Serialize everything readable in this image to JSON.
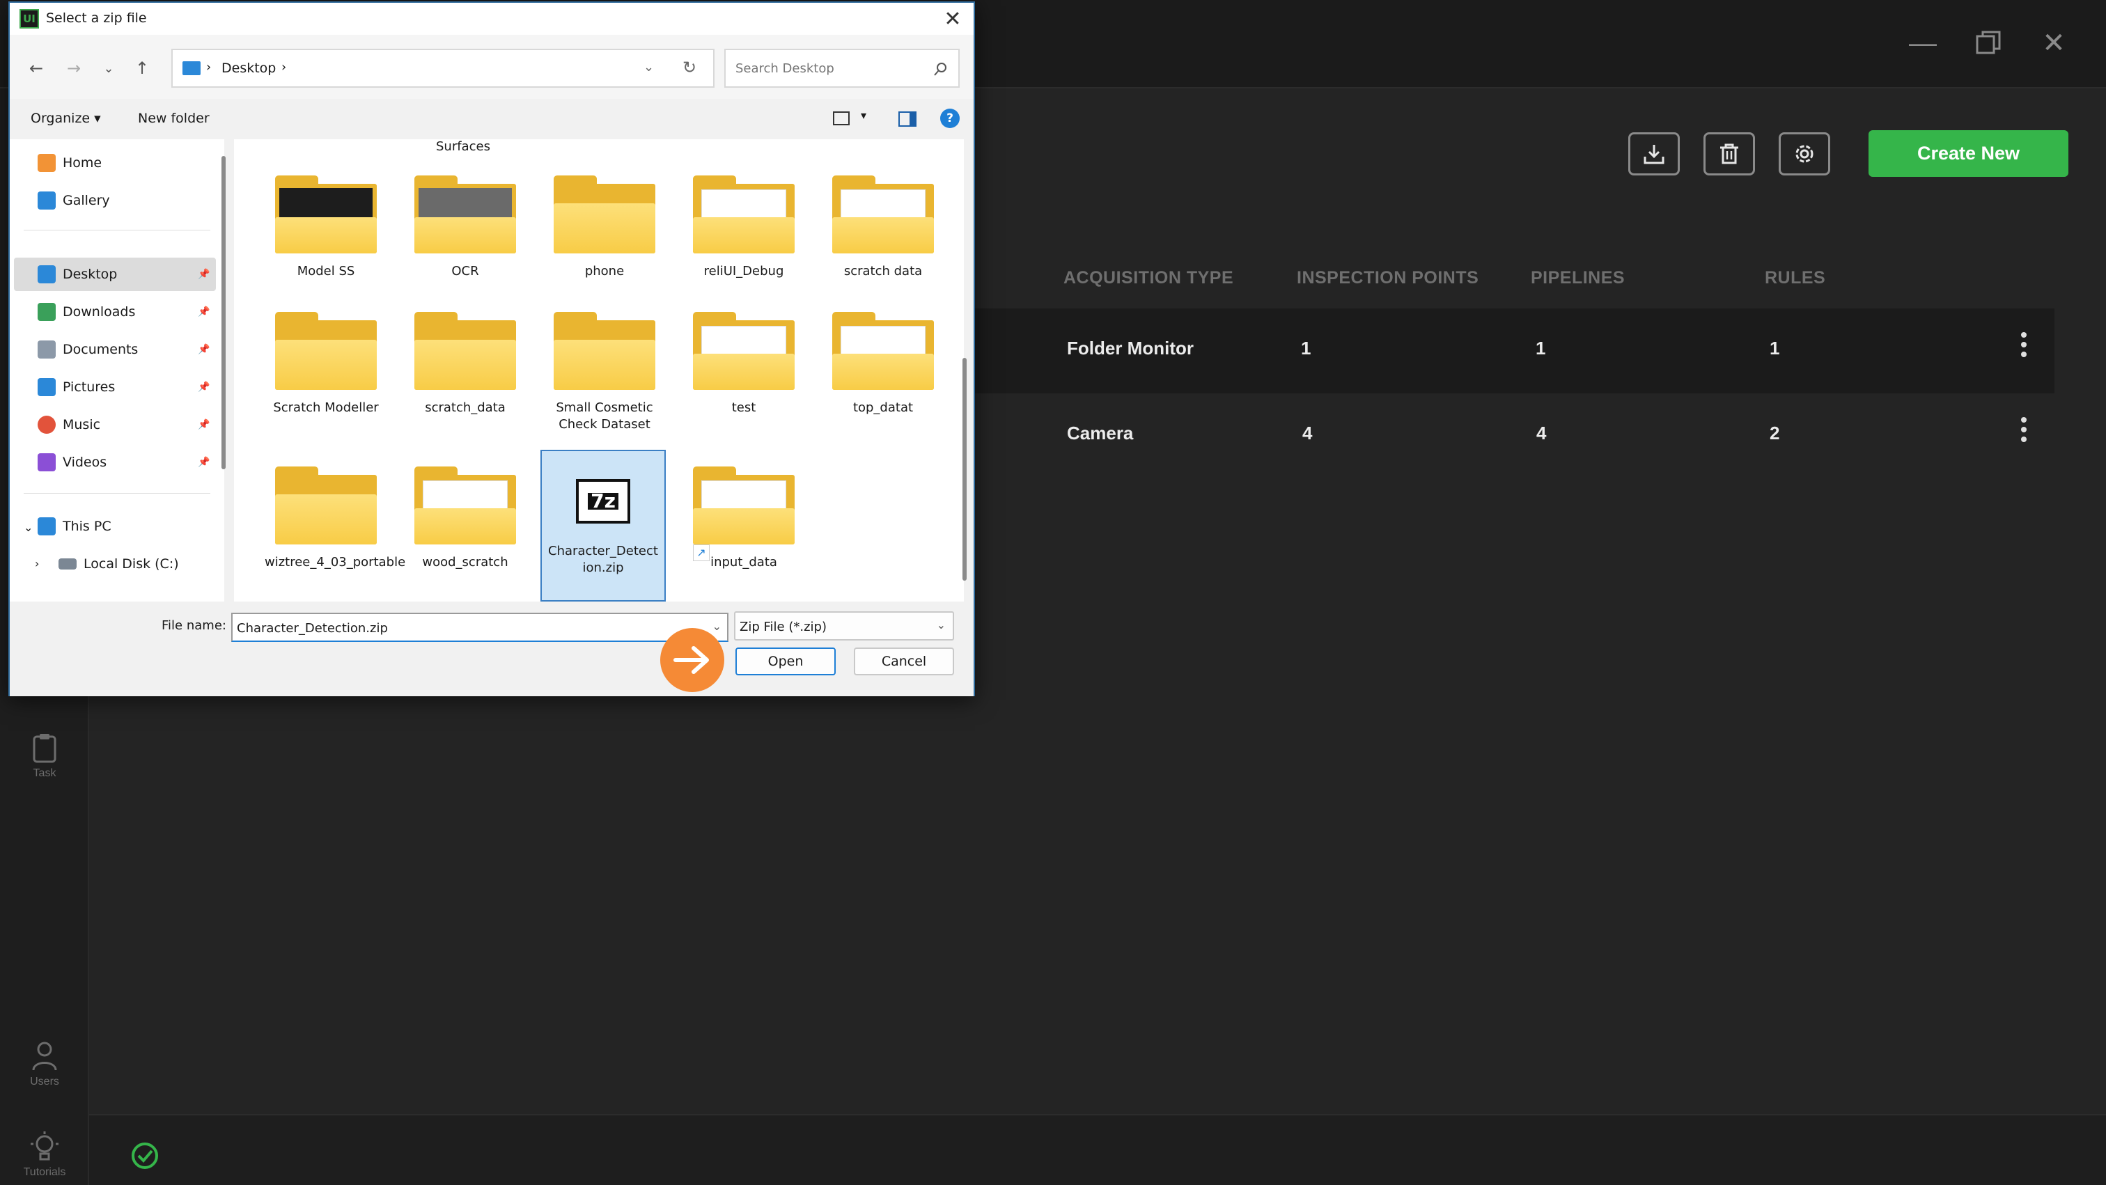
{
  "app": {
    "toolbar": {
      "create_new": "Create New"
    },
    "table": {
      "headers": [
        "ACQUISITION TYPE",
        "INSPECTION POINTS",
        "PIPELINES",
        "RULES"
      ],
      "rows": [
        {
          "acquisition_type": "Folder Monitor",
          "inspection_points": "1",
          "pipelines": "1",
          "rules": "1"
        },
        {
          "acquisition_type": "Camera",
          "inspection_points": "4",
          "pipelines": "4",
          "rules": "2"
        }
      ]
    },
    "sidebar": {
      "task": "Task",
      "users": "Users",
      "tutorials": "Tutorials"
    },
    "colors": {
      "accent": "#35b54a",
      "background": "#242424",
      "marker": "#f58a36"
    }
  },
  "dialog": {
    "app_icon": "UI",
    "title": "Select a zip file",
    "address": {
      "location": "Desktop"
    },
    "search_placeholder": "Search Desktop",
    "commands": {
      "organize": "Organize",
      "new_folder": "New folder"
    },
    "nav": {
      "home": "Home",
      "gallery": "Gallery",
      "desktop": "Desktop",
      "downloads": "Downloads",
      "documents": "Documents",
      "pictures": "Pictures",
      "music": "Music",
      "videos": "Videos",
      "this_pc": "This PC",
      "local_disk": "Local Disk (C:)"
    },
    "partial_label": "Surfaces",
    "files": [
      {
        "name": "Model SS"
      },
      {
        "name": "OCR"
      },
      {
        "name": "phone"
      },
      {
        "name": "reliUI_Debug"
      },
      {
        "name": "scratch data"
      },
      {
        "name": "Scratch Modeller"
      },
      {
        "name": "scratch_data"
      },
      {
        "name": "Small Cosmetic Check Dataset"
      },
      {
        "name": "test"
      },
      {
        "name": "top_datat"
      },
      {
        "name": "wiztree_4_03_portable"
      },
      {
        "name": "wood_scratch"
      },
      {
        "name": "Character_Detection.zip",
        "selected": true,
        "icon_text": "7z"
      },
      {
        "name": "input_data"
      }
    ],
    "file_name_label": "File name:",
    "file_name_value": "Character_Detection.zip",
    "file_type": "Zip File (*.zip)",
    "open_button": "Open",
    "cancel_button": "Cancel"
  }
}
